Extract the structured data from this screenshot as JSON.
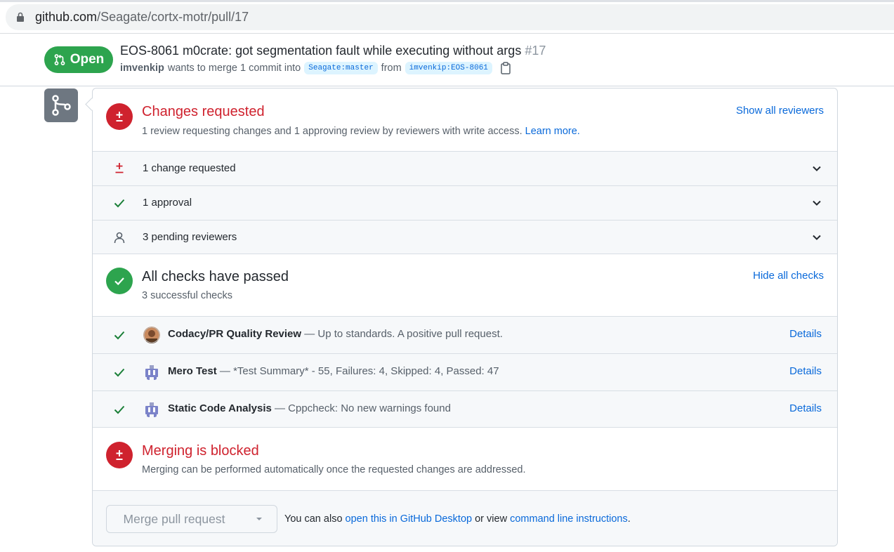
{
  "browser": {
    "url_host": "github.com",
    "url_path": "/Seagate/cortx-motr/pull/17"
  },
  "pr": {
    "state_label": "Open",
    "title": "EOS-8061 m0crate: got segmentation fault while executing without args",
    "number": "#17",
    "author": "imvenkip",
    "merge_text": "wants to merge 1 commit into",
    "base_branch": "Seagate:master",
    "from_text": "from",
    "head_branch": "imvenkip:EOS-8061"
  },
  "review": {
    "title": "Changes requested",
    "subtitle": "1 review requesting changes and 1 approving review by reviewers with write access.",
    "learn_more": "Learn more.",
    "show_all": "Show all reviewers",
    "rows": [
      {
        "label": "1 change requested",
        "icon": "diff-icon"
      },
      {
        "label": "1 approval",
        "icon": "check-icon"
      },
      {
        "label": "3 pending reviewers",
        "icon": "person-icon"
      }
    ]
  },
  "checks": {
    "title": "All checks have passed",
    "subtitle": "3 successful checks",
    "hide_all": "Hide all checks",
    "items": [
      {
        "name": "Codacy/PR Quality Review",
        "desc": " — Up to standards. A positive pull request.",
        "details": "Details"
      },
      {
        "name": "Mero Test",
        "desc": " — *Test Summary* - 55, Failures: 4, Skipped: 4, Passed: 47",
        "details": "Details"
      },
      {
        "name": "Static Code Analysis",
        "desc": " — Cppcheck: No new warnings found",
        "details": "Details"
      }
    ]
  },
  "blocked": {
    "title": "Merging is blocked",
    "subtitle": "Merging can be performed automatically once the requested changes are addressed."
  },
  "footer": {
    "merge_button": "Merge pull request",
    "text_pre": "You can also ",
    "desktop_link": "open this in GitHub Desktop",
    "text_mid": " or view ",
    "cli_link": "command line instructions",
    "text_post": "."
  },
  "colors": {
    "open_green": "#2da44e",
    "danger_red": "#cf222e",
    "link_blue": "#0969da"
  }
}
